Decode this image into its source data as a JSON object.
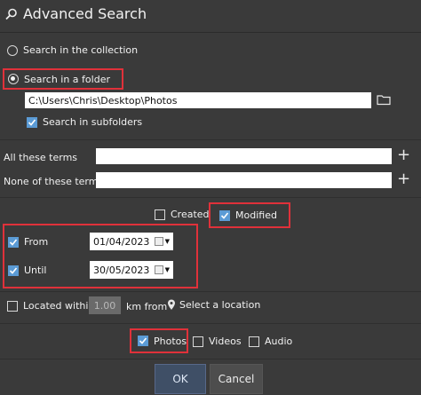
{
  "dialog": {
    "title": "Advanced Search"
  },
  "scope": {
    "collection_label": "Search in the collection",
    "folder_label": "Search in a folder",
    "folder_path": "C:\\Users\\Chris\\Desktop\\Photos",
    "subfolders_label": "Search in subfolders"
  },
  "terms": {
    "all_label": "All these terms",
    "all_value": "",
    "none_label": "None of these terms",
    "none_value": "",
    "plus": "+"
  },
  "date_type": {
    "created_label": "Created",
    "modified_label": "Modified"
  },
  "date_range": {
    "from_label": "From",
    "from_value": "01/04/2023",
    "until_label": "Until",
    "until_value": "30/05/2023"
  },
  "location": {
    "located_within_label": "Located within",
    "distance_value": "1.00",
    "km_from_label": "km from",
    "select_location_label": "Select a location"
  },
  "media": {
    "photos_label": "Photos",
    "videos_label": "Videos",
    "audio_label": "Audio"
  },
  "buttons": {
    "ok_label": "OK",
    "cancel_label": "Cancel"
  },
  "colors": {
    "background": "#3a3a3a",
    "highlight": "#e0313a",
    "check": "#5b9bd5"
  }
}
